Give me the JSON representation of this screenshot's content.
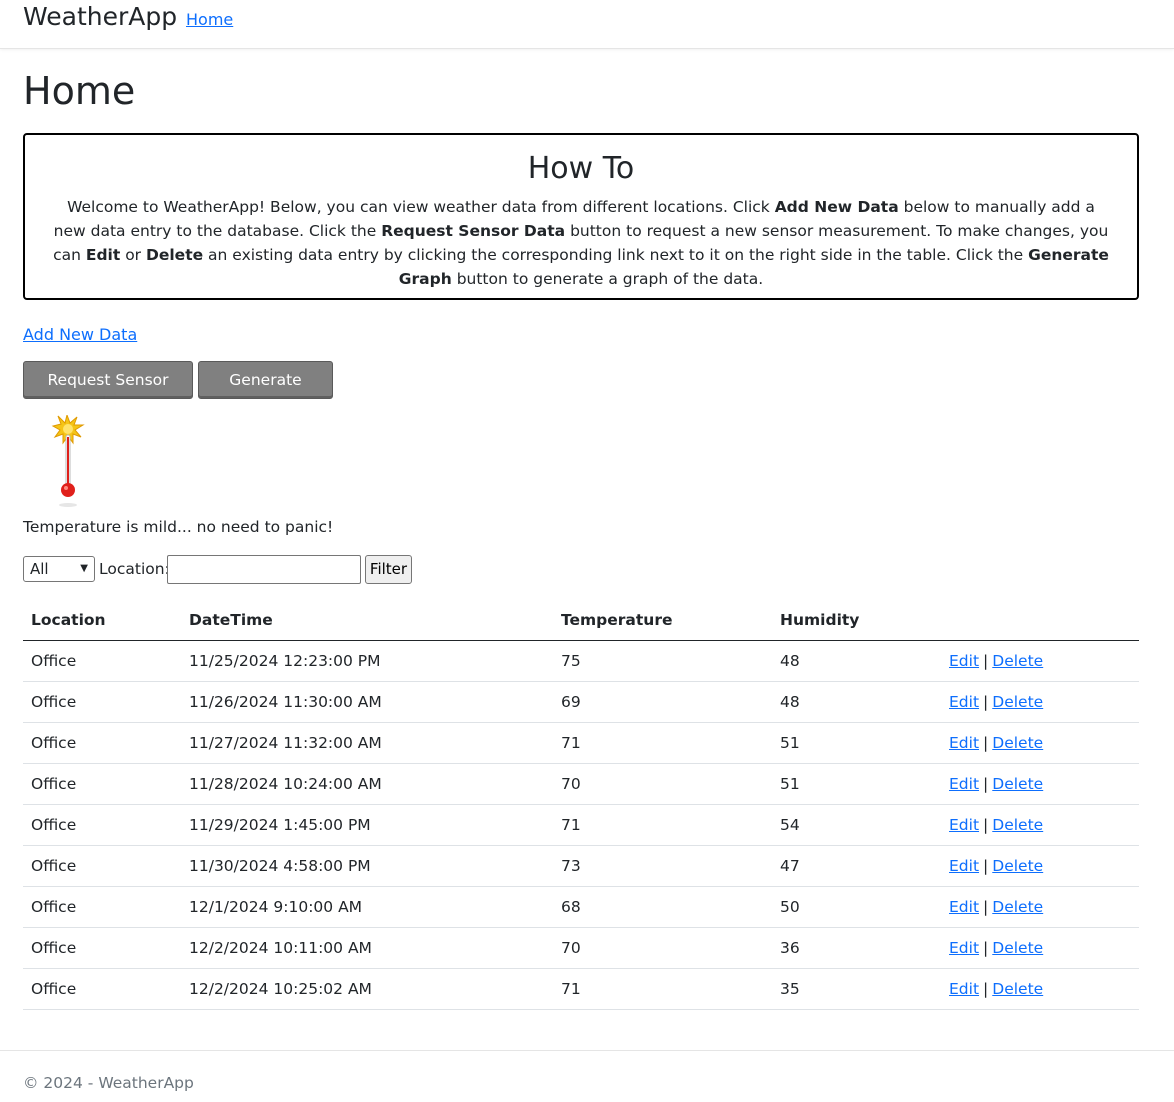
{
  "navbar": {
    "brand": "WeatherApp",
    "home_link": "Home"
  },
  "page": {
    "title": "Home"
  },
  "howto": {
    "title": "How To",
    "p1": "Welcome to WeatherApp! Below, you can view weather data from different locations. Click ",
    "b1": "Add New Data",
    "p2": " below to manually add a new data entry to the database. Click the ",
    "b2": "Request Sensor Data",
    "p3": " button to request a new sensor measurement. To make changes, you can ",
    "b3": "Edit",
    "p4": " or ",
    "b4": "Delete",
    "p5": " an existing data entry by clicking the corresponding link next to it on the right side in the table. Click the ",
    "b5": "Generate Graph",
    "p6": " button to generate a graph of the data."
  },
  "actions": {
    "add_new_data": "Add New Data",
    "request_sensor_data": "Request Sensor Data",
    "generate_graph": "Generate Graph"
  },
  "status": {
    "icon": "thermometer-icon",
    "message": "Temperature is mild... no need to panic!"
  },
  "filter": {
    "select_value": "All",
    "location_label": "Location:",
    "location_value": "",
    "button": "Filter"
  },
  "table": {
    "headers": {
      "location": "Location",
      "datetime": "DateTime",
      "temperature": "Temperature",
      "humidity": "Humidity"
    },
    "edit_label": "Edit",
    "delete_label": "Delete",
    "separator": "|",
    "rows": [
      {
        "location": "Office",
        "datetime": "11/25/2024 12:23:00 PM",
        "temperature": "75",
        "humidity": "48"
      },
      {
        "location": "Office",
        "datetime": "11/26/2024 11:30:00 AM",
        "temperature": "69",
        "humidity": "48"
      },
      {
        "location": "Office",
        "datetime": "11/27/2024 11:32:00 AM",
        "temperature": "71",
        "humidity": "51"
      },
      {
        "location": "Office",
        "datetime": "11/28/2024 10:24:00 AM",
        "temperature": "70",
        "humidity": "51"
      },
      {
        "location": "Office",
        "datetime": "11/29/2024 1:45:00 PM",
        "temperature": "71",
        "humidity": "54"
      },
      {
        "location": "Office",
        "datetime": "11/30/2024 4:58:00 PM",
        "temperature": "73",
        "humidity": "47"
      },
      {
        "location": "Office",
        "datetime": "12/1/2024 9:10:00 AM",
        "temperature": "68",
        "humidity": "50"
      },
      {
        "location": "Office",
        "datetime": "12/2/2024 10:11:00 AM",
        "temperature": "70",
        "humidity": "36"
      },
      {
        "location": "Office",
        "datetime": "12/2/2024 10:25:02 AM",
        "temperature": "71",
        "humidity": "35"
      }
    ]
  },
  "footer": {
    "text": "© 2024 - WeatherApp"
  }
}
